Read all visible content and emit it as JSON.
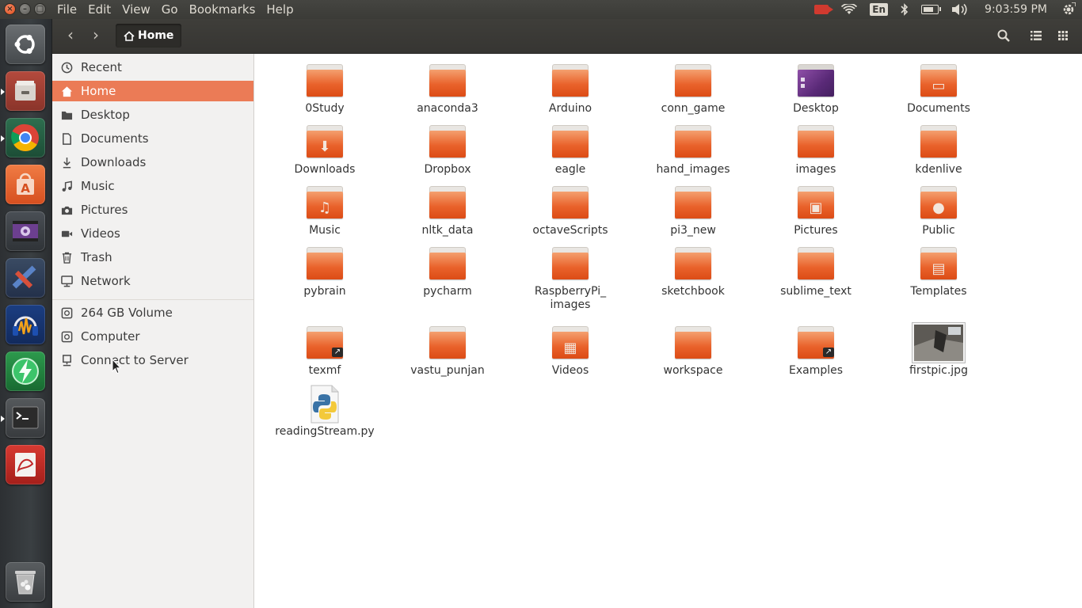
{
  "menu": [
    "File",
    "Edit",
    "View",
    "Go",
    "Bookmarks",
    "Help"
  ],
  "indicators": {
    "keyboard_layout": "En",
    "clock": "9:03:59 PM"
  },
  "toolbar": {
    "path_label": "Home"
  },
  "sidebar": {
    "items": [
      {
        "label": "Recent",
        "icon": "clock-icon"
      },
      {
        "label": "Home",
        "icon": "home-icon",
        "active": true
      },
      {
        "label": "Desktop",
        "icon": "folder-icon"
      },
      {
        "label": "Documents",
        "icon": "document-icon"
      },
      {
        "label": "Downloads",
        "icon": "download-icon"
      },
      {
        "label": "Music",
        "icon": "music-icon"
      },
      {
        "label": "Pictures",
        "icon": "camera-icon"
      },
      {
        "label": "Videos",
        "icon": "video-icon"
      },
      {
        "label": "Trash",
        "icon": "trash-icon"
      },
      {
        "label": "Network",
        "icon": "network-icon"
      }
    ],
    "devices": [
      {
        "label": "264 GB Volume",
        "icon": "drive-icon"
      },
      {
        "label": "Computer",
        "icon": "computer-icon"
      },
      {
        "label": "Connect to Server",
        "icon": "server-icon"
      }
    ]
  },
  "files": [
    {
      "name": "0Study",
      "type": "folder"
    },
    {
      "name": "anaconda3",
      "type": "folder"
    },
    {
      "name": "Arduino",
      "type": "folder"
    },
    {
      "name": "conn_game",
      "type": "folder"
    },
    {
      "name": "Desktop",
      "type": "desktop-folder"
    },
    {
      "name": "Documents",
      "type": "documents-folder"
    },
    {
      "name": "Downloads",
      "type": "downloads-folder"
    },
    {
      "name": "Dropbox",
      "type": "folder"
    },
    {
      "name": "eagle",
      "type": "folder"
    },
    {
      "name": "hand_images",
      "type": "folder"
    },
    {
      "name": "images",
      "type": "folder"
    },
    {
      "name": "kdenlive",
      "type": "folder"
    },
    {
      "name": "Music",
      "type": "music-folder"
    },
    {
      "name": "nltk_data",
      "type": "folder"
    },
    {
      "name": "octaveScripts",
      "type": "folder"
    },
    {
      "name": "pi3_new",
      "type": "folder"
    },
    {
      "name": "Pictures",
      "type": "pictures-folder"
    },
    {
      "name": "Public",
      "type": "public-folder"
    },
    {
      "name": "pybrain",
      "type": "folder"
    },
    {
      "name": "pycharm",
      "type": "folder"
    },
    {
      "name": "RaspberryPi_ images",
      "type": "folder"
    },
    {
      "name": "sketchbook",
      "type": "folder"
    },
    {
      "name": "sublime_text",
      "type": "folder"
    },
    {
      "name": "Templates",
      "type": "templates-folder"
    },
    {
      "name": "texmf",
      "type": "link-folder"
    },
    {
      "name": "vastu_punjan",
      "type": "folder"
    },
    {
      "name": "Videos",
      "type": "videos-folder"
    },
    {
      "name": "workspace",
      "type": "folder"
    },
    {
      "name": "Examples",
      "type": "link-folder"
    },
    {
      "name": "firstpic.jpg",
      "type": "image"
    },
    {
      "name": "readingStream.py",
      "type": "python"
    }
  ],
  "colors": {
    "accent": "#eb7b56",
    "panel": "#3c3b37",
    "launcher": "#33373a",
    "folder": "#e9622b"
  }
}
